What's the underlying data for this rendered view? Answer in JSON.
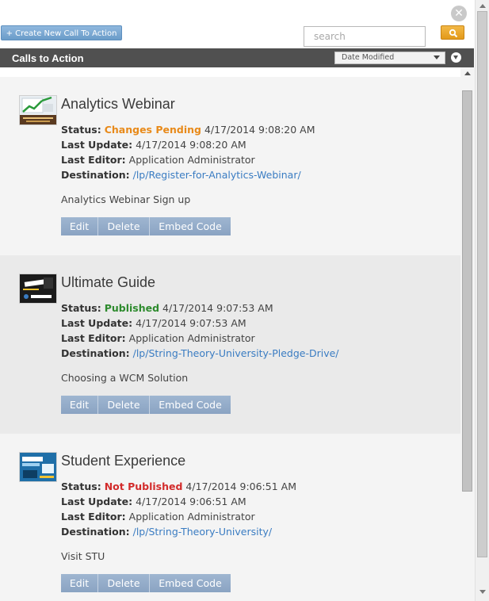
{
  "toolbar": {
    "create_label": "+ Create New Call To Action",
    "search_placeholder": "search"
  },
  "header": {
    "title": "Calls to Action",
    "sort_value": "Date Modified"
  },
  "labels": {
    "status": "Status:",
    "last_update": "Last Update:",
    "last_editor": "Last Editor:",
    "destination": "Destination:",
    "edit": "Edit",
    "delete": "Delete",
    "embed": "Embed Code"
  },
  "items": [
    {
      "title": "Analytics Webinar",
      "status": "Changes Pending",
      "status_time": "4/17/2014 9:08:20 AM",
      "last_update": "4/17/2014 9:08:20 AM",
      "last_editor": "Application Administrator",
      "destination": "/lp/Register-for-Analytics-Webinar/",
      "description": "Analytics Webinar Sign up",
      "status_color": "#e88a1a"
    },
    {
      "title": "Ultimate Guide",
      "status": "Published",
      "status_time": "4/17/2014 9:07:53 AM",
      "last_update": "4/17/2014 9:07:53 AM",
      "last_editor": "Application Administrator",
      "destination": "/lp/String-Theory-University-Pledge-Drive/",
      "description": "Choosing a WCM Solution",
      "status_color": "#2e8b2e"
    },
    {
      "title": "Student Experience",
      "status": "Not Published",
      "status_time": "4/17/2014 9:06:51 AM",
      "last_update": "4/17/2014 9:06:51 AM",
      "last_editor": "Application Administrator",
      "destination": "/lp/String-Theory-University/",
      "description": "Visit STU",
      "status_color": "#d22b2b"
    }
  ]
}
